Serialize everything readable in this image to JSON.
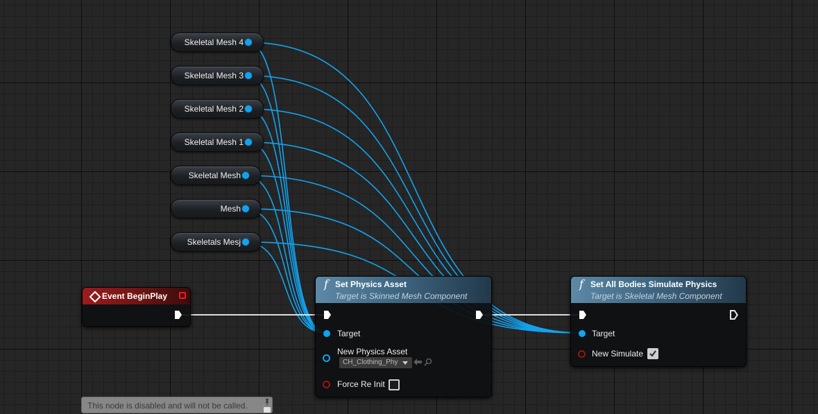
{
  "variables": [
    {
      "label": "Skeletal Mesh 4"
    },
    {
      "label": "Skeletal Mesh 3"
    },
    {
      "label": "Skeletal Mesh 2"
    },
    {
      "label": "Skeletal Mesh 1"
    },
    {
      "label": "Skeletal Mesh"
    },
    {
      "label": "Mesh"
    },
    {
      "label": "Skeletals Mesj"
    }
  ],
  "event_node": {
    "title": "Event BeginPlay"
  },
  "set_physics_asset": {
    "title": "Set Physics Asset",
    "subtitle": "Target is Skinned Mesh Component",
    "target_label": "Target",
    "new_physics_asset_label": "New Physics Asset",
    "asset_value": "CH_Clothing_Phy",
    "force_reinit_label": "Force Re Init",
    "force_reinit_checked": false
  },
  "set_all_bodies": {
    "title": "Set All Bodies Simulate Physics",
    "subtitle": "Target is Skeletal Mesh Component",
    "target_label": "Target",
    "new_simulate_label": "New Simulate",
    "new_simulate_checked": true
  },
  "disabled_note": {
    "text": "This node is disabled and will not be called."
  },
  "colors": {
    "object_pin": "#12a3ef",
    "bool_pin": "#9a1515",
    "event_header": "#9c1c1c",
    "function_header": "#5d89a6",
    "exec_wire": "#e0e0e0"
  },
  "icons": {
    "function": "f-function-icon",
    "event": "event-diamond-icon",
    "exec": "exec-arrow-icon"
  }
}
